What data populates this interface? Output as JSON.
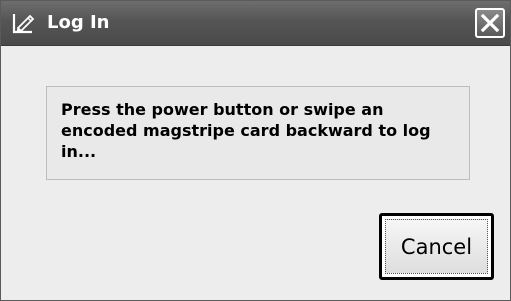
{
  "window": {
    "title": "Log In",
    "icon": "pen-edit-icon",
    "close_icon": "close-x-icon",
    "close_glyph": "✕"
  },
  "dialog": {
    "message": "Press the power button or swipe an encoded magstripe card backward to log in...",
    "cancel_label": "Cancel"
  },
  "colors": {
    "titlebar": "#555555",
    "title_text": "#ffffff",
    "body_background": "#ededed",
    "message_background": "#e9e9e9",
    "button_border": "#000000"
  }
}
